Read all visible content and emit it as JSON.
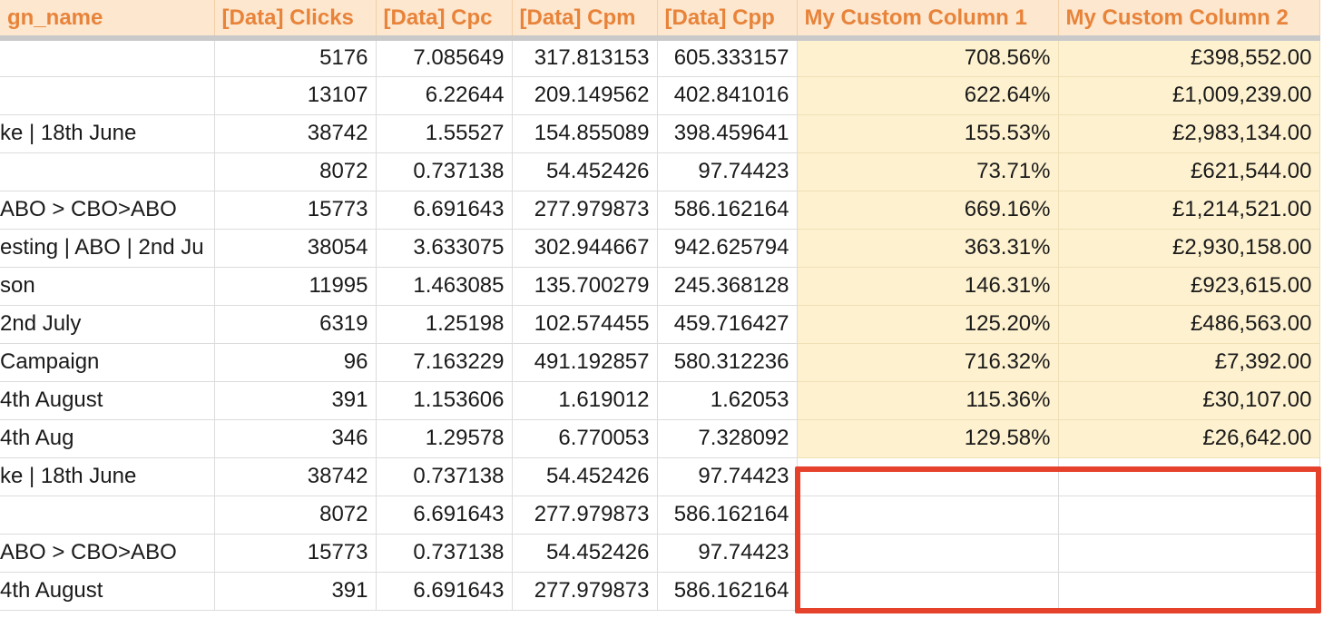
{
  "headers": [
    "gn_name",
    "[Data] Clicks",
    "[Data] Cpc",
    "[Data] Cpm",
    "[Data] Cpp",
    "My Custom Column 1",
    "My Custom Column 2"
  ],
  "rows": [
    {
      "name": "",
      "clicks": "5176",
      "cpc": "7.085649",
      "cpm": "317.813153",
      "cpp": "605.333157",
      "c1": "708.56%",
      "c2": "£398,552.00"
    },
    {
      "name": "",
      "clicks": "13107",
      "cpc": "6.22644",
      "cpm": "209.149562",
      "cpp": "402.841016",
      "c1": "622.64%",
      "c2": "£1,009,239.00"
    },
    {
      "name": "ke | 18th June",
      "clicks": "38742",
      "cpc": "1.55527",
      "cpm": "154.855089",
      "cpp": "398.459641",
      "c1": "155.53%",
      "c2": "£2,983,134.00"
    },
    {
      "name": "",
      "clicks": "8072",
      "cpc": "0.737138",
      "cpm": "54.452426",
      "cpp": "97.74423",
      "c1": "73.71%",
      "c2": "£621,544.00"
    },
    {
      "name": "ABO > CBO>ABO",
      "clicks": "15773",
      "cpc": "6.691643",
      "cpm": "277.979873",
      "cpp": "586.162164",
      "c1": "669.16%",
      "c2": "£1,214,521.00"
    },
    {
      "name": "esting | ABO | 2nd Ju",
      "clicks": "38054",
      "cpc": "3.633075",
      "cpm": "302.944667",
      "cpp": "942.625794",
      "c1": "363.31%",
      "c2": "£2,930,158.00"
    },
    {
      "name": "son",
      "clicks": "11995",
      "cpc": "1.463085",
      "cpm": "135.700279",
      "cpp": "245.368128",
      "c1": "146.31%",
      "c2": "£923,615.00"
    },
    {
      "name": "2nd July",
      "clicks": "6319",
      "cpc": "1.25198",
      "cpm": "102.574455",
      "cpp": "459.716427",
      "c1": "125.20%",
      "c2": "£486,563.00"
    },
    {
      "name": " Campaign",
      "clicks": "96",
      "cpc": "7.163229",
      "cpm": "491.192857",
      "cpp": "580.312236",
      "c1": "716.32%",
      "c2": "£7,392.00"
    },
    {
      "name": "4th August",
      "clicks": "391",
      "cpc": "1.153606",
      "cpm": "1.619012",
      "cpp": "1.62053",
      "c1": "115.36%",
      "c2": "£30,107.00"
    },
    {
      "name": "4th Aug",
      "clicks": "346",
      "cpc": "1.29578",
      "cpm": "6.770053",
      "cpp": "7.328092",
      "c1": "129.58%",
      "c2": "£26,642.00"
    },
    {
      "name": "ke | 18th June",
      "clicks": "38742",
      "cpc": "0.737138",
      "cpm": "54.452426",
      "cpp": "97.74423",
      "c1": "",
      "c2": ""
    },
    {
      "name": "",
      "clicks": "8072",
      "cpc": "6.691643",
      "cpm": "277.979873",
      "cpp": "586.162164",
      "c1": "",
      "c2": ""
    },
    {
      "name": "ABO > CBO>ABO",
      "clicks": "15773",
      "cpc": "0.737138",
      "cpm": "54.452426",
      "cpp": "97.74423",
      "c1": "",
      "c2": ""
    },
    {
      "name": "4th August",
      "clicks": "391",
      "cpc": "6.691643",
      "cpm": "277.979873",
      "cpp": "586.162164",
      "c1": "",
      "c2": ""
    }
  ],
  "filled_custom_rows": 11,
  "colors": {
    "header_bg": "#fde7cf",
    "header_text": "#e8833a",
    "custom_fill": "#fdf1cf",
    "highlight": "#e6412b"
  }
}
